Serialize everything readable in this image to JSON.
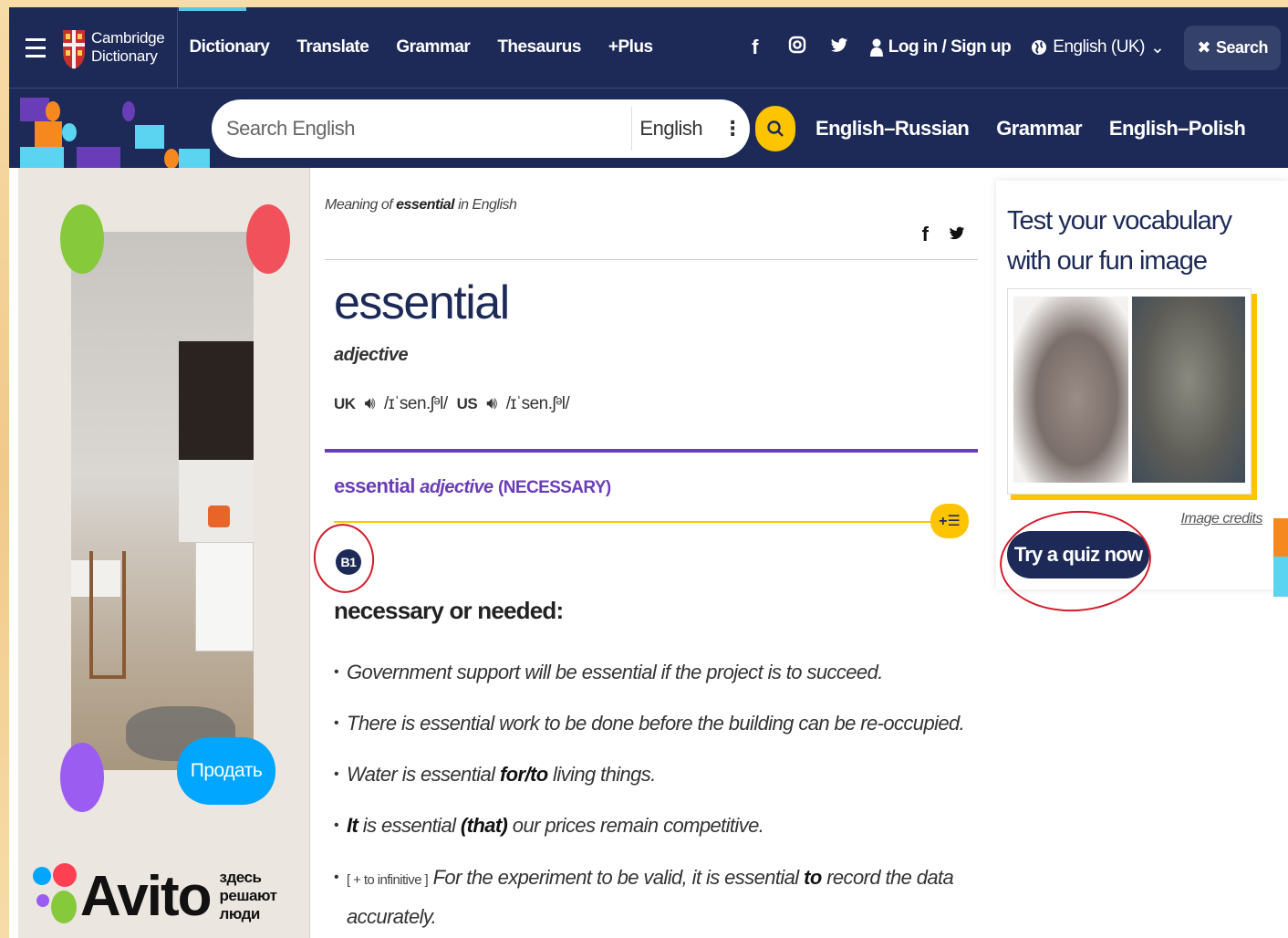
{
  "app": {
    "brand_line1": "Cambridge",
    "brand_line2": "Dictionary"
  },
  "topnav": {
    "links": [
      "Dictionary",
      "Translate",
      "Grammar",
      "Thesaurus",
      "+Plus"
    ],
    "login": "Log in / Sign up",
    "language": "English (UK)",
    "search_button": "Search"
  },
  "searchbar": {
    "placeholder": "Search English",
    "dictionary": "English",
    "quicklinks": [
      "English–Russian",
      "Grammar",
      "English–Polish"
    ]
  },
  "left_ad": {
    "sell_button": "Продать",
    "brand": "Avito",
    "tagline_line1": "здесь решают",
    "tagline_line2": "люди"
  },
  "entry": {
    "breadcrumb_prefix": "Meaning of",
    "breadcrumb_word": "essential",
    "breadcrumb_suffix": "in English",
    "headword": "essential",
    "pos": "adjective",
    "uk_label": "UK",
    "uk_ipa": "/ɪˈsen.ʃᵊl/",
    "us_label": "US",
    "us_ipa": "/ɪˈsen.ʃᵊl/",
    "sense_word": "essential",
    "sense_pos": "adjective",
    "sense_guide": "(NECESSARY)",
    "level": "B1",
    "definition": "necessary or needed:",
    "examples": {
      "e1": "Government support will be essential if the project is to succeed.",
      "e2": "There is essential work to be done before the building can be re-occupied.",
      "e3_a": "Water is essential ",
      "e3_b": "for/to",
      "e3_c": " living things.",
      "e4_a": "It",
      "e4_b": " is essential ",
      "e4_c": "(that)",
      "e4_d": " our prices remain competitive.",
      "e5_gram": "[ + to infinitive ]",
      "e5_a": " For the experiment to be valid, it is essential ",
      "e5_b": "to",
      "e5_c": " record the data",
      "e5_d": "accurately."
    }
  },
  "quiz": {
    "title": "Test your vocabulary with our fun image quizzes",
    "credits": "Image credits",
    "button": "Try a quiz now"
  },
  "colors": {
    "navy": "#1d2a57",
    "gold": "#fec400",
    "purple": "#6a3db8",
    "annotation_red": "#d21d2b"
  }
}
